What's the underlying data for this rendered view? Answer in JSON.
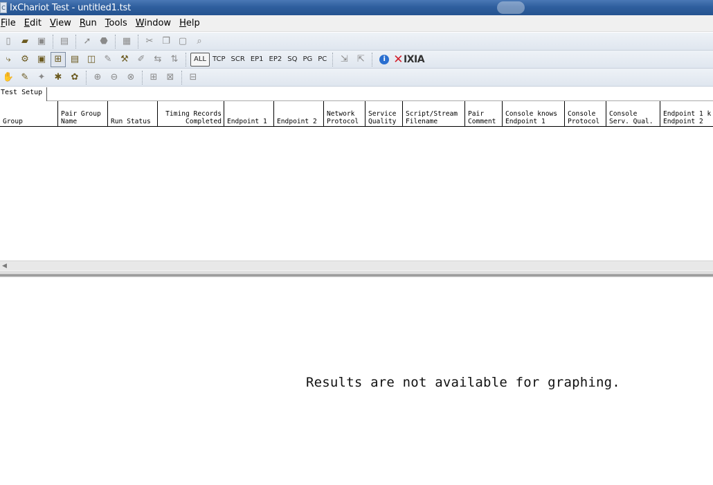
{
  "window": {
    "title": "IxChariot Test - untitled1.tst",
    "icon": "C\nC"
  },
  "menu": [
    {
      "mnemonic": "F",
      "rest": "ile"
    },
    {
      "mnemonic": "E",
      "rest": "dit"
    },
    {
      "mnemonic": "V",
      "rest": "iew"
    },
    {
      "mnemonic": "R",
      "rest": "un"
    },
    {
      "mnemonic": "T",
      "rest": "ools"
    },
    {
      "mnemonic": "W",
      "rest": "indow"
    },
    {
      "mnemonic": "H",
      "rest": "elp"
    }
  ],
  "toolbar2": {
    "filters": [
      "ALL",
      "TCP",
      "SCR",
      "EP1",
      "EP2",
      "SQ",
      "PG",
      "PC"
    ],
    "logo_text": "IXIA",
    "info_glyph": "i"
  },
  "tabs": {
    "test_setup": "Test Setup"
  },
  "grid": {
    "columns": [
      {
        "line1": "",
        "line2": "Group"
      },
      {
        "line1": "Pair Group",
        "line2": "Name"
      },
      {
        "line1": "",
        "line2": "Run Status"
      },
      {
        "line1": "Timing Records",
        "line2": "Completed"
      },
      {
        "line1": "",
        "line2": "Endpoint 1"
      },
      {
        "line1": "",
        "line2": "Endpoint 2"
      },
      {
        "line1": "Network",
        "line2": "Protocol"
      },
      {
        "line1": "Service",
        "line2": "Quality"
      },
      {
        "line1": "Script/Stream",
        "line2": "Filename"
      },
      {
        "line1": "Pair",
        "line2": "Comment"
      },
      {
        "line1": "Console knows",
        "line2": "Endpoint 1"
      },
      {
        "line1": "Console",
        "line2": "Protocol"
      },
      {
        "line1": "Console",
        "line2": "Serv. Qual."
      },
      {
        "line1": "Endpoint 1 k",
        "line2": "Endpoint 2"
      }
    ]
  },
  "graph": {
    "message": "Results are not available for graphing."
  },
  "scroll": {
    "left_arrow": "◀"
  }
}
